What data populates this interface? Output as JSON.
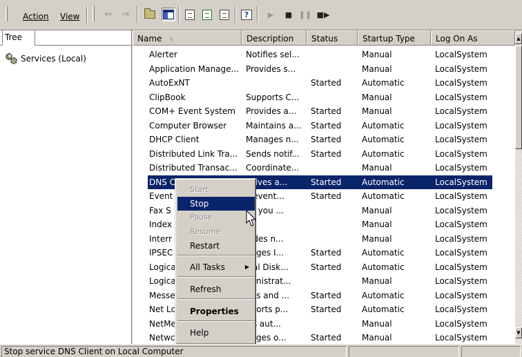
{
  "menu": {
    "action": "Action",
    "view": "View"
  },
  "toolbar": {
    "icons": [
      "back-arrow",
      "forward-arrow",
      "up-folder",
      "show-hide-tree",
      "properties",
      "refresh",
      "export-list",
      "help",
      "start-service",
      "stop-service",
      "pause-service",
      "restart-service"
    ]
  },
  "tree": {
    "tab_label": "Tree",
    "root_label": "Services (Local)"
  },
  "columns": {
    "name": "Name",
    "description": "Description",
    "status": "Status",
    "startup_type": "Startup Type",
    "log_on_as": "Log On As"
  },
  "services": [
    {
      "name": "Alerter",
      "description": "Notifies sel...",
      "status": "",
      "startup": "Manual",
      "logon": "LocalSystem"
    },
    {
      "name": "Application Manage...",
      "description": "Provides s...",
      "status": "",
      "startup": "Manual",
      "logon": "LocalSystem"
    },
    {
      "name": "AutoExNT",
      "description": "",
      "status": "Started",
      "startup": "Automatic",
      "logon": "LocalSystem"
    },
    {
      "name": "ClipBook",
      "description": "Supports C...",
      "status": "",
      "startup": "Manual",
      "logon": "LocalSystem"
    },
    {
      "name": "COM+ Event System",
      "description": "Provides a...",
      "status": "Started",
      "startup": "Manual",
      "logon": "LocalSystem"
    },
    {
      "name": "Computer Browser",
      "description": "Maintains a...",
      "status": "Started",
      "startup": "Automatic",
      "logon": "LocalSystem"
    },
    {
      "name": "DHCP Client",
      "description": "Manages n...",
      "status": "Started",
      "startup": "Automatic",
      "logon": "LocalSystem"
    },
    {
      "name": "Distributed Link Tra...",
      "description": "Sends notif...",
      "status": "Started",
      "startup": "Automatic",
      "logon": "LocalSystem"
    },
    {
      "name": "Distributed Transac...",
      "description": "Coordinate...",
      "status": "",
      "startup": "Manual",
      "logon": "LocalSystem"
    },
    {
      "name": "DNS Cl",
      "description": "solves a...",
      "status": "Started",
      "startup": "Automatic",
      "logon": "LocalSystem"
    },
    {
      "name": "Event",
      "description": "s event...",
      "status": "Started",
      "startup": "Automatic",
      "logon": "LocalSystem"
    },
    {
      "name": "Fax S",
      "description": "ps you ...",
      "status": "",
      "startup": "Manual",
      "logon": "LocalSystem"
    },
    {
      "name": "Index",
      "description": "",
      "status": "",
      "startup": "Manual",
      "logon": "LocalSystem"
    },
    {
      "name": "Interr",
      "description": "vides n...",
      "status": "",
      "startup": "Manual",
      "logon": "LocalSystem"
    },
    {
      "name": "IPSEC",
      "description": "nages I...",
      "status": "Started",
      "startup": "Automatic",
      "logon": "LocalSystem"
    },
    {
      "name": "Logica",
      "description": "ical Disk...",
      "status": "Started",
      "startup": "Automatic",
      "logon": "LocalSystem"
    },
    {
      "name": "Logica",
      "description": "ministrat...",
      "status": "",
      "startup": "Manual",
      "logon": "LocalSystem"
    },
    {
      "name": "Messe",
      "description": "nds and ...",
      "status": "Started",
      "startup": "Automatic",
      "logon": "LocalSystem"
    },
    {
      "name": "Net Lc",
      "description": "pports p...",
      "status": "Started",
      "startup": "Automatic",
      "logon": "LocalSystem"
    },
    {
      "name": "NetMe",
      "description": "ws aut...",
      "status": "",
      "startup": "Manual",
      "logon": "LocalSystem"
    },
    {
      "name": "Netwc",
      "description": "nages o...",
      "status": "Started",
      "startup": "Manual",
      "logon": "LocalSystem"
    }
  ],
  "selected_index": 9,
  "context_menu": {
    "start": "Start",
    "stop": "Stop",
    "pause": "Pause",
    "resume": "Resume",
    "restart": "Restart",
    "all_tasks": "All Tasks",
    "refresh": "Refresh",
    "properties": "Properties",
    "help": "Help"
  },
  "status_bar": {
    "message": "Stop service DNS Client on Local Computer"
  },
  "colors": {
    "selection": "#0a246a",
    "chrome": "#d4d0c8"
  }
}
